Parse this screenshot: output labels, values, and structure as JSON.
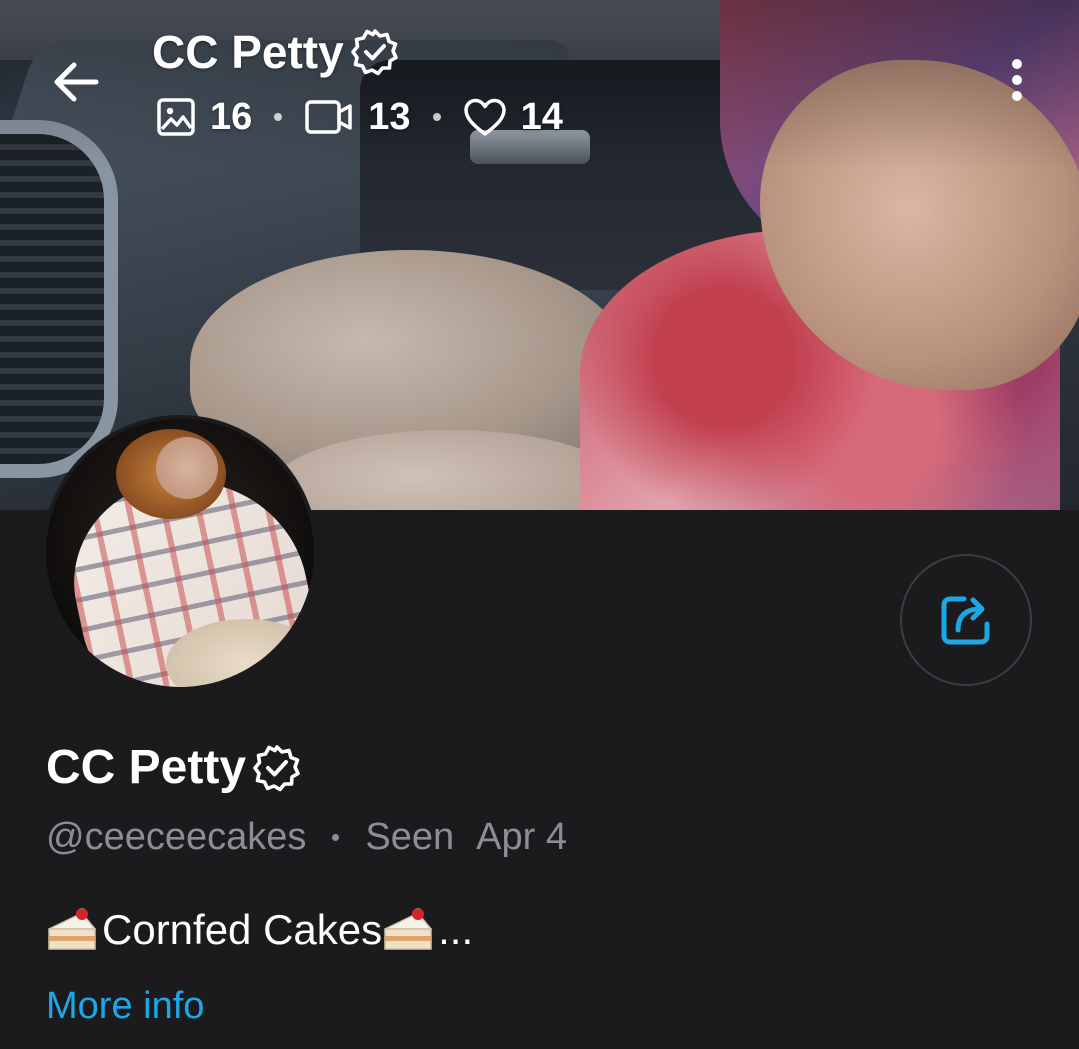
{
  "header": {
    "title": "CC Petty",
    "stats": {
      "photos": "16",
      "videos": "13",
      "likes": "14"
    }
  },
  "profile": {
    "name": "CC Petty",
    "handle": "@ceeceecakes",
    "seen_label": "Seen",
    "seen_date": "Apr 4",
    "bio_text": "Cornfed Cakes",
    "bio_ellipsis": "...",
    "more_info": "More info"
  },
  "icons": {
    "back": "arrow-left-icon",
    "verified": "verified-badge-icon",
    "photos": "image-icon",
    "videos": "video-icon",
    "likes": "heart-icon",
    "more": "vertical-dots-icon",
    "share": "share-icon",
    "cake": "cake-slice-emoji"
  },
  "colors": {
    "background": "#1b1b1d",
    "accent": "#1da7e6",
    "muted_text": "#8b8e96"
  }
}
